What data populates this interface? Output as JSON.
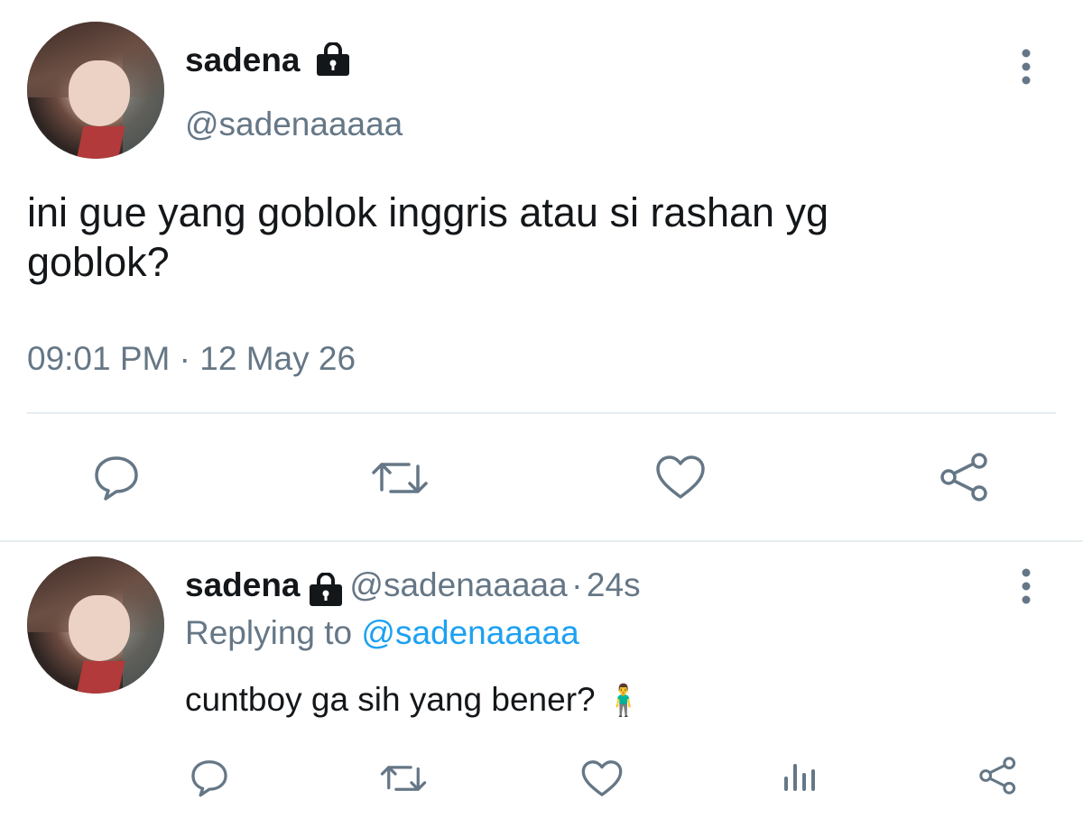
{
  "main_tweet": {
    "display_name": "sadena",
    "handle": "@sadenaaaaa",
    "text_line1": "ini gue yang goblok inggris atau si rashan yg",
    "text_line2": "goblok?",
    "time": "09:01 PM",
    "separator": "·",
    "date": "12 May 26",
    "actions": [
      "reply-icon",
      "retweet-icon",
      "like-icon",
      "share-icon"
    ]
  },
  "reply_tweet": {
    "display_name": "sadena",
    "handle": "@sadenaaaaa",
    "separator": "·",
    "age": "24s",
    "replying_prefix": "Replying to",
    "replying_to": "@sadenaaaaa",
    "text": "cuntboy ga sih yang bener?",
    "emoji": "🧍‍♂️",
    "actions": [
      "reply-icon",
      "retweet-icon",
      "like-icon",
      "analytics-icon",
      "share-icon"
    ]
  },
  "colors": {
    "text": "#14171a",
    "secondary": "#657786",
    "link": "#1da1f2",
    "divider": "#e6ecf0",
    "icon": "#657786"
  }
}
